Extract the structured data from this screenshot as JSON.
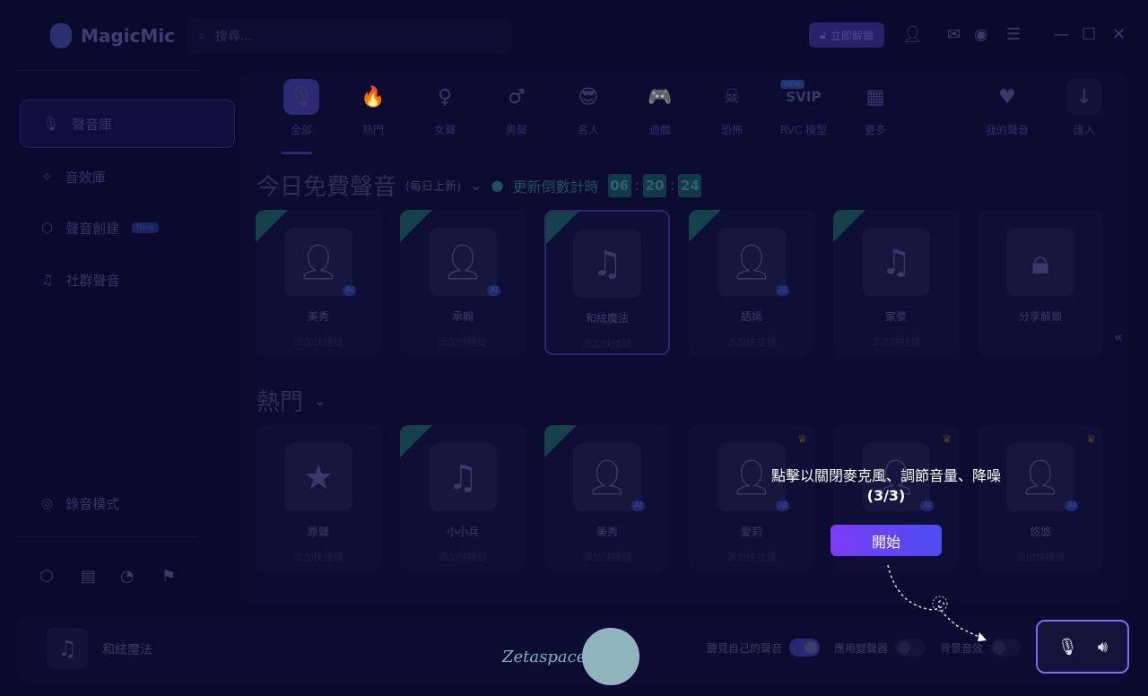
{
  "app": {
    "name": "MagicMic"
  },
  "search": {
    "placeholder": "搜尋..."
  },
  "header": {
    "unlock_label": "立即解鎖"
  },
  "sidebar": {
    "items": [
      {
        "label": "聲音庫",
        "icon": "mic-icon",
        "active": true
      },
      {
        "label": "音效庫",
        "icon": "sparkle-icon"
      },
      {
        "label": "聲音創建",
        "icon": "cube-icon",
        "badge": "New"
      },
      {
        "label": "社群聲音",
        "icon": "music-folder-icon"
      }
    ],
    "record_mode": "錄音模式"
  },
  "tabs": [
    {
      "label": "全部",
      "icon": "🎙"
    },
    {
      "label": "熱門",
      "icon": "🔥"
    },
    {
      "label": "女聲",
      "icon": "♀"
    },
    {
      "label": "男聲",
      "icon": "♂"
    },
    {
      "label": "名人",
      "icon": "😎"
    },
    {
      "label": "遊戲",
      "icon": "🎮"
    },
    {
      "label": "恐怖",
      "icon": "☠"
    },
    {
      "label": "RVC 模型",
      "icon": "SVIP",
      "badge": "new"
    },
    {
      "label": "更多",
      "icon": "▦"
    }
  ],
  "right_tabs": [
    {
      "label": "我的聲音",
      "icon": "♥"
    },
    {
      "label": "匯入",
      "icon": "↓"
    }
  ],
  "free_section": {
    "title": "今日免費聲音",
    "subtitle": "(每日上新)",
    "countdown_label": "更新倒數計時",
    "countdown": [
      "06",
      "20",
      "24"
    ],
    "cards": [
      {
        "name": "美秀",
        "sub": "添加快捷鍵",
        "free": true,
        "ai": "AI"
      },
      {
        "name": "承翰",
        "sub": "添加快捷鍵",
        "free": true,
        "ai": "AI"
      },
      {
        "name": "和絃魔法",
        "sub": "添加快捷鍵",
        "free": true
      },
      {
        "name": "語嫣",
        "sub": "添加快捷鍵",
        "free": true,
        "ai": "AI"
      },
      {
        "name": "家豪",
        "sub": "添加快捷鍵",
        "free": true
      },
      {
        "name": "分享解鎖",
        "sub": ""
      }
    ]
  },
  "hot_section": {
    "title": "熱門",
    "cards": [
      {
        "name": "原聲",
        "sub": "添加快捷鍵"
      },
      {
        "name": "小小兵",
        "sub": "添加快捷鍵",
        "free": true
      },
      {
        "name": "美秀",
        "sub": "添加快捷鍵",
        "free": true,
        "ai": "AI"
      },
      {
        "name": "愛莉",
        "sub": "添加快捷鍵",
        "crown": true,
        "ai": "AI"
      },
      {
        "name": "",
        "sub": "",
        "crown": true,
        "ai": "AI"
      },
      {
        "name": "悠悠",
        "sub": "添加快捷鍵",
        "crown": true,
        "ai": "AI"
      }
    ]
  },
  "player": {
    "current_voice": "和絃魔法",
    "hear_myself": "聽見自己的聲音",
    "hear_myself_on": true,
    "voice_changer": "應用變聲器",
    "voice_changer_on": false,
    "bg_sound": "背景音效",
    "bg_sound_on": false
  },
  "tooltip": {
    "text": "點擊以關閉麥克風、調節音量、降噪",
    "step": "(3/3)",
    "button": "開始"
  },
  "watermark": "Zetaspace",
  "colors": {
    "accent": "#7b6cf0",
    "button_start": "#7b3cf5",
    "button_end": "#4c4cf0"
  }
}
